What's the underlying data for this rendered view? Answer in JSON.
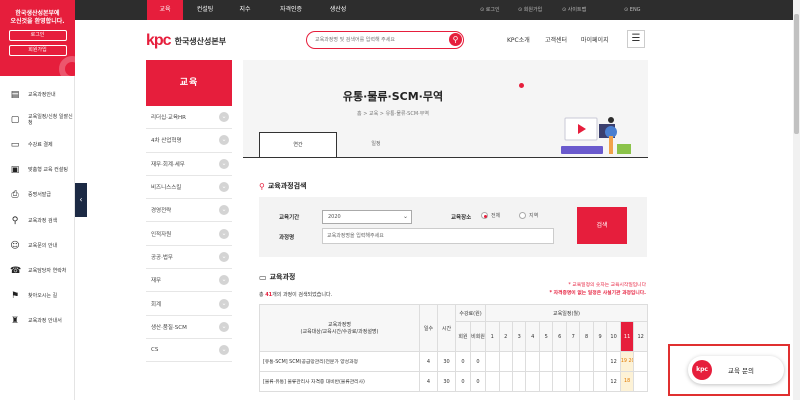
{
  "sidebar": {
    "notice": [
      "한국생산성본부에",
      "오신것을 환영합니다."
    ],
    "login_label": "로그인",
    "join_label": "회원가입",
    "items": [
      {
        "icon": "book-icon",
        "label": "교육과정안내"
      },
      {
        "icon": "document-icon",
        "label": "교육일정/신청 일괄신청"
      },
      {
        "icon": "card-icon",
        "label": "수강료 결제"
      },
      {
        "icon": "laptop-icon",
        "label": "맞춤형 교육 컨설팅"
      },
      {
        "icon": "printer-icon",
        "label": "증명서발급"
      },
      {
        "icon": "search-icon",
        "label": "교육과정 검색"
      },
      {
        "icon": "people-icon",
        "label": "교육문의 안내"
      },
      {
        "icon": "phone-icon",
        "label": "교육담당자 연락처"
      },
      {
        "icon": "map-pin-icon",
        "label": "찾아오시는 길"
      },
      {
        "icon": "certificate-icon",
        "label": "교육과정 안내서"
      }
    ]
  },
  "topnav": {
    "tabs": [
      "교육",
      "컨설팅",
      "지수",
      "자격인증",
      "생산성"
    ],
    "utils": [
      "로그인",
      "회원가입",
      "사이트맵",
      "ENG"
    ]
  },
  "header": {
    "logo_mark": "kpc",
    "logo_name": "한국생산성본부",
    "search_placeholder": "교육과정명 및 검색어를 입력해 주세요",
    "links": [
      "KPC소개",
      "고객센터",
      "마이페이지"
    ]
  },
  "category_menu": {
    "title": "교육",
    "items": [
      "리더십·교육HR",
      "4차 산업혁명",
      "재무·회계·세무",
      "비즈니스스킬",
      "경영전략",
      "인적자원",
      "공공·법무",
      "재무",
      "회계",
      "생산·품질·SCM",
      "CS"
    ]
  },
  "hero": {
    "title": "유통·물류·SCM·무역",
    "breadcrumb": "홈 > 교육 > 유통·물류·SCM·무역",
    "tabs": [
      "연간",
      "일정"
    ]
  },
  "search_panel": {
    "title": "교육과정검색",
    "year_label": "교육기간",
    "year_value": "2020",
    "place_label": "교육장소",
    "place_options": [
      "전체",
      "지역"
    ],
    "keyword_label": "과정명",
    "keyword_placeholder": "교육과정명을 입력해주세요",
    "submit_label": "검색"
  },
  "course_table": {
    "title": "교육과정",
    "count_prefix": "총",
    "count_value": "41",
    "count_suffix": "개의 과정이 검색되었습니다.",
    "note1": "* 교육일정의 숫자는 교육시작일입니다",
    "note2": "* 자격증명이 없는 일정은 사설기관 과정입니다.",
    "headers": {
      "course": "교육과정명",
      "course_sub": "(교육대상/교육시간/수강료/과정설명)",
      "days": "일수",
      "hours": "시간",
      "fee": "수강료",
      "fee_sub": "(원)",
      "fee_members": [
        "회원",
        "비회원"
      ],
      "schedule": "교육일정(월)",
      "months": [
        "1",
        "2",
        "3",
        "4",
        "5",
        "6",
        "7",
        "8",
        "9",
        "10",
        "11",
        "12"
      ],
      "highlight_month": "11"
    },
    "rows": [
      {
        "title": "[유통·SCM] SCM(공급망관리)전문가 양성과정",
        "days": "4",
        "hours": "30",
        "fee1": "0",
        "fee2": "0",
        "month11": "12",
        "month12": "19 20"
      },
      {
        "title": "[물류·유통] 물류관리사 자격증 대비반(물류관리사)",
        "days": "4",
        "hours": "30",
        "fee1": "0",
        "fee2": "0",
        "month11": "12",
        "month12": "18"
      }
    ]
  },
  "inquiry": {
    "logo": "kpc",
    "label": "교육 문의"
  },
  "colors": {
    "brand": "#e61e3c",
    "topbar": "#2d2d2d",
    "sidebar_toggle": "#1c2a44"
  }
}
